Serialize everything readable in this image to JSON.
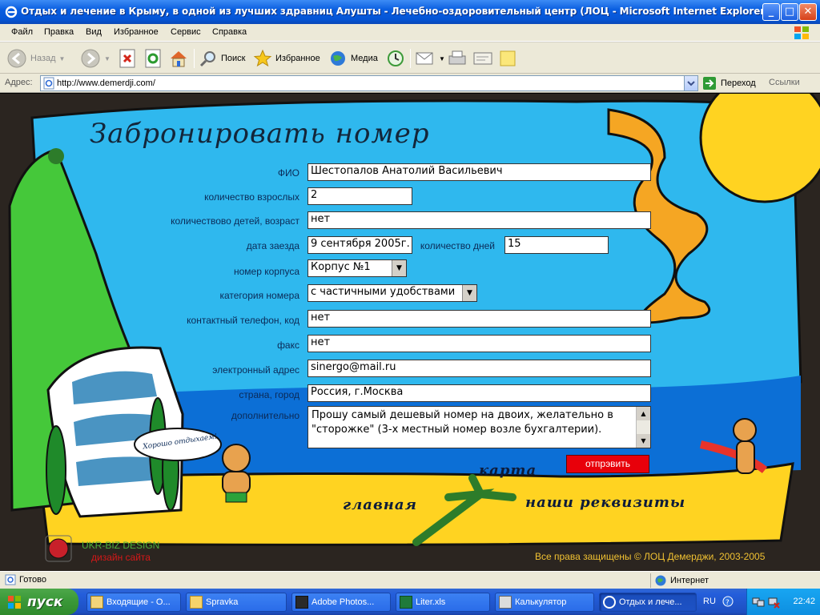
{
  "window": {
    "title": "Отдых и лечение в Крыму, в одной из лучших здравниц Алушты - Лечебно-оздоровительный центр (ЛОЦ - Microsoft Internet Explorer",
    "min_glyph": "_",
    "max_glyph": "□",
    "close_glyph": "✕"
  },
  "menu": [
    "Файл",
    "Правка",
    "Вид",
    "Избранное",
    "Сервис",
    "Справка"
  ],
  "toolbar": {
    "back": "Назад",
    "search": "Поиск",
    "favorites": "Избранное",
    "media": "Медиа"
  },
  "address": {
    "label": "Адрес:",
    "url": "http://www.demerdji.com/",
    "go": "Переход",
    "links": "Ссылки"
  },
  "form": {
    "heading": "Забронировать номер",
    "fio_label": "ФИО",
    "fio_value": "Шестопалов Анатолий Васильевич",
    "adults_label": "количество взрослых",
    "adults_value": "2",
    "children_label": "количествово детей, возраст",
    "children_value": "нет",
    "arrival_label": "дата заезда",
    "arrival_value": "9 сентября 2005г.",
    "days_label": "количество дней",
    "days_value": "15",
    "building_label": "номер корпуса",
    "building_value": "Корпус №1",
    "category_label": "категория номера",
    "category_value": "с частичными удобствами",
    "phone_label": "контактный телефон, код",
    "phone_value": "нет",
    "fax_label": "факс",
    "fax_value": "нет",
    "email_label": "электронный адрес",
    "email_value": "sinergo@mail.ru",
    "city_label": "страна, город",
    "city_value": "Россия, г.Москва",
    "extra_label": "дополнительно",
    "extra_value": "Прошу самый дешевый номер на двоих, желательно в \"сторожке\" (3-х местный номер возле бухгалтерии).",
    "submit": "отпрэвить"
  },
  "nav": {
    "map": "карта",
    "home": "главная",
    "details": "наши реквизиты"
  },
  "bubble": "Хорошо отдыхаем!",
  "footer": {
    "brand": "UKR-BIZ DESIGN",
    "sub": "дизайн сайта",
    "copyright": "Все права защищены © ЛОЦ Демерджи, 2003-2005"
  },
  "status": {
    "text": "Готово",
    "zone": "Интернет"
  },
  "taskbar": {
    "start": "пуск",
    "tasks": [
      "Входящие - О...",
      "Spravka",
      "Adobe Photos...",
      "Liter.xls",
      "Калькулятор",
      "Отдых и лече..."
    ],
    "lang": "RU",
    "clock": "22:42"
  },
  "colors": {
    "sky": "#2fb8ee",
    "sea": "#0c6fd6",
    "sand": "#ffd321",
    "button": "#e8000a"
  }
}
